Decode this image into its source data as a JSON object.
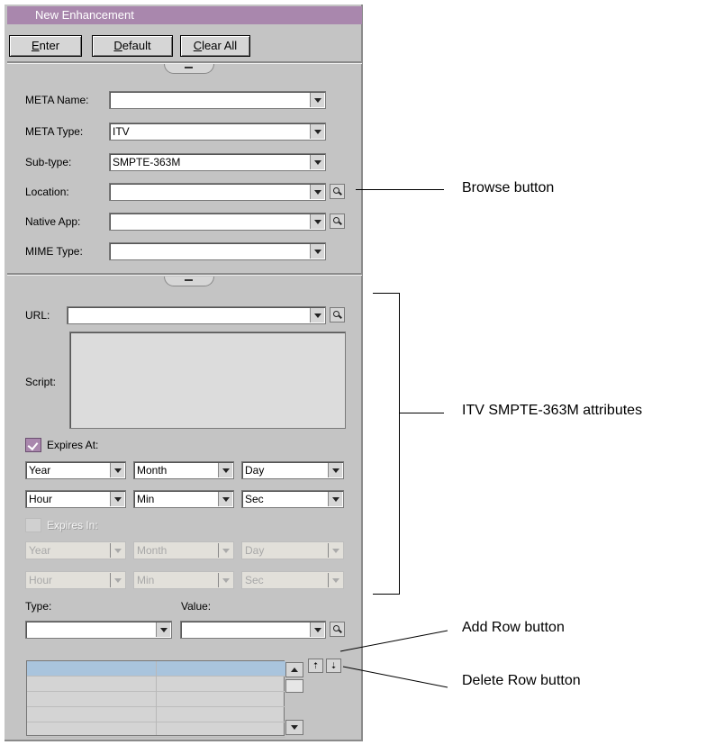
{
  "window": {
    "title": "New Enhancement"
  },
  "toolbar": {
    "enter_label": "Enter",
    "default_label": "Default",
    "clear_all_label": "Clear All"
  },
  "meta": {
    "name_label": "META Name:",
    "name_value": "",
    "type_label": "META Type:",
    "type_value": "ITV",
    "subtype_label": "Sub-type:",
    "subtype_value": "SMPTE-363M",
    "location_label": "Location:",
    "location_value": "",
    "native_app_label": "Native App:",
    "native_app_value": "",
    "mime_label": "MIME Type:",
    "mime_value": ""
  },
  "itv": {
    "url_label": "URL:",
    "url_value": "",
    "script_label": "Script:",
    "expires_at": {
      "label": "Expires At:",
      "checked": true,
      "year": "Year",
      "month": "Month",
      "day": "Day",
      "hour": "Hour",
      "min": "Min",
      "sec": "Sec"
    },
    "expires_in": {
      "label": "Expires In:",
      "checked": false,
      "enabled": false,
      "year": "Year",
      "month": "Month",
      "day": "Day",
      "hour": "Hour",
      "min": "Min",
      "sec": "Sec"
    }
  },
  "pairs": {
    "type_label": "Type:",
    "value_label": "Value:",
    "type_value": "",
    "value_value": ""
  },
  "annotations": {
    "browse": "Browse button",
    "itv_attrs": "ITV SMPTE-363M attributes",
    "add_row": "Add Row button",
    "delete_row": "Delete Row button"
  },
  "colors": {
    "title_bar": "#a987ad",
    "panel": "#c4c4c4",
    "table_selection": "#a9c4dd"
  },
  "icons": {
    "browse": "magnifier-icon",
    "add_row": "add-row-icon",
    "delete_row": "delete-row-icon"
  }
}
